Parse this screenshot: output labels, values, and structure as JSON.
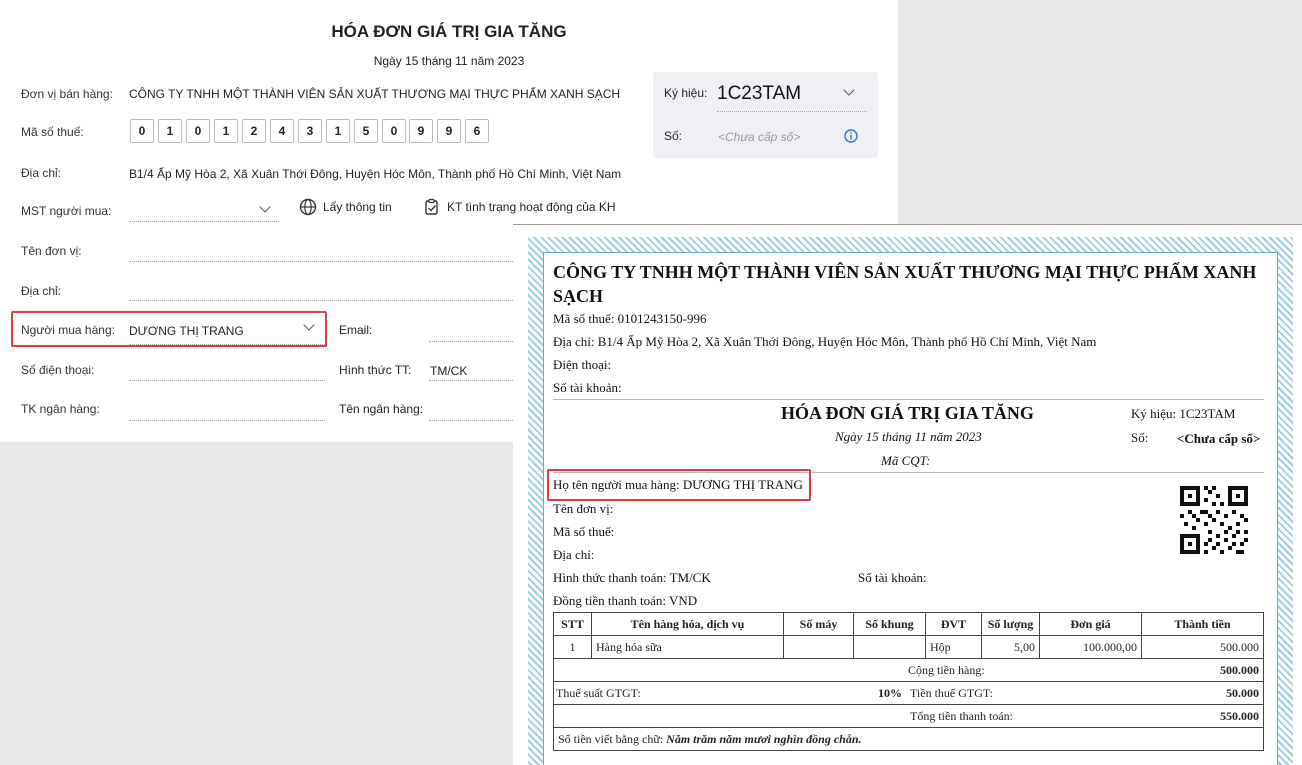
{
  "form": {
    "title": "HÓA ĐƠN GIÁ TRỊ GIA TĂNG",
    "date": "Ngày 15 tháng 11 năm 2023",
    "seller_label": "Đơn vị bán hàng:",
    "seller_value": "CÔNG TY TNHH MỘT THÀNH VIÊN SẢN XUẤT THƯƠNG MẠI THỰC PHẨM XANH SẠCH",
    "tax_label": "Mã số thuế:",
    "tax_digits": [
      "0",
      "1",
      "0",
      "1",
      "2",
      "4",
      "3",
      "1",
      "5",
      "0",
      "9",
      "9",
      "6"
    ],
    "address_label": "Địa chỉ:",
    "address_value": "B1/4 Ấp Mỹ Hòa 2, Xã Xuân Thới Đông, Huyện Hóc Môn, Thành phố Hồ Chí Minh, Việt Nam",
    "buyer_tax_label": "MST người mua:",
    "fetch_info_label": "Lấy thông tin",
    "check_status_label": "KT tình trạng hoạt động của KH",
    "unit_name_label": "Tên đơn vị:",
    "address2_label": "Địa chỉ:",
    "buyer_label": "Người mua hàng:",
    "buyer_value": "DƯƠNG THỊ TRANG",
    "email_label": "Email:",
    "phone_label": "Số điện thoại:",
    "payment_label": "Hình thức TT:",
    "payment_value": "TM/CK",
    "bank_account_label": "TK ngân hàng:",
    "bank_name_label": "Tên ngân hàng:",
    "symbol_label": "Ký hiệu:",
    "symbol_value": "1C23TAM",
    "number_label": "Số:",
    "number_placeholder": "<Chưa cấp số>"
  },
  "invoice": {
    "company_line1": "CÔNG TY TNHH MỘT THÀNH VIÊN SẢN XUẤT THƯƠNG MẠI THỰC PHẨM XANH",
    "company_line2": "SẠCH",
    "tax_line": "Mã số thuế: 0101243150-996",
    "address_line": "Địa chỉ: B1/4 Ấp Mỹ Hòa 2, Xã Xuân Thới Đông, Huyện Hóc Môn, Thành phố Hồ Chí Minh, Việt Nam",
    "phone_line": "Điện thoại:",
    "account_line": "Số tài khoản:",
    "title": "HÓA ĐƠN GIÁ TRỊ GIA TĂNG",
    "date": "Ngày 15 tháng 11 năm 2023",
    "cqt": "Mã CQT:",
    "symbol_line": "Ký hiệu: 1C23TAM",
    "number_label": "Số:",
    "number_value": "<Chưa cấp số>",
    "buyer_line": "Họ tên người mua hàng: DƯƠNG THỊ TRANG",
    "unit_line": "Tên đơn vị:",
    "tax_code_line": "Mã số thuế:",
    "address2_line": "Địa chỉ:",
    "payment_line": "Hình thức thanh toán: TM/CK",
    "account2_line": "Số tài khoản:",
    "currency_line": "Đồng tiền thanh toán: VND",
    "columns": [
      "STT",
      "Tên hàng hóa, dịch vụ",
      "Số máy",
      "Số khung",
      "ĐVT",
      "Số lượng",
      "Đơn giá",
      "Thành tiền"
    ],
    "row": [
      "1",
      "Hàng hóa sữa",
      "",
      "",
      "Hộp",
      "5,00",
      "100.000,00",
      "500.000"
    ],
    "subtotal_label": "Cộng tiền hàng:",
    "subtotal_value": "500.000",
    "vat_rate_label": "Thuế suất GTGT:",
    "vat_rate_value": "10%",
    "vat_amount_label": "Tiền thuế GTGT:",
    "vat_amount_value": "50.000",
    "total_label": "Tổng tiền thanh toán:",
    "total_value": "550.000",
    "words_label": "Số tiền viết bằng chữ:",
    "words_value": "Năm trăm năm mươi nghìn đồng chẵn."
  }
}
